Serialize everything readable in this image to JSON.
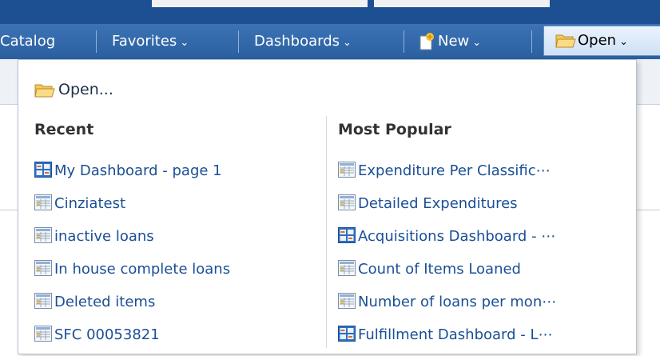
{
  "nav": {
    "catalog": "Catalog",
    "favorites": "Favorites",
    "dashboards": "Dashboards",
    "new": "New",
    "open": "Open",
    "chevron": "⌄"
  },
  "menu": {
    "open_item": "Open...",
    "recent_heading": "Recent",
    "popular_heading": "Most Popular",
    "recent": [
      {
        "label": "My Dashboard - page 1",
        "icon": "dashboard-icon"
      },
      {
        "label": "Cinziatest",
        "icon": "report-icon"
      },
      {
        "label": "inactive loans",
        "icon": "report-icon"
      },
      {
        "label": "In house complete loans",
        "icon": "report-icon"
      },
      {
        "label": "Deleted items",
        "icon": "report-icon"
      },
      {
        "label": "SFC 00053821",
        "icon": "report-icon"
      }
    ],
    "popular": [
      {
        "label": "Expenditure Per Classific⋯",
        "icon": "report-icon"
      },
      {
        "label": "Detailed Expenditures",
        "icon": "report-icon"
      },
      {
        "label": "Acquisitions Dashboard - ⋯",
        "icon": "dashboard-icon"
      },
      {
        "label": "Count of Items Loaned",
        "icon": "report-icon"
      },
      {
        "label": "Number of loans per mon⋯",
        "icon": "report-icon"
      },
      {
        "label": "Fulfillment Dashboard - L⋯",
        "icon": "dashboard-icon"
      }
    ]
  },
  "colors": {
    "topbar": "#1d4f93",
    "navbar": "#2f66a8",
    "link": "#1a4f95",
    "heading": "#333333"
  }
}
